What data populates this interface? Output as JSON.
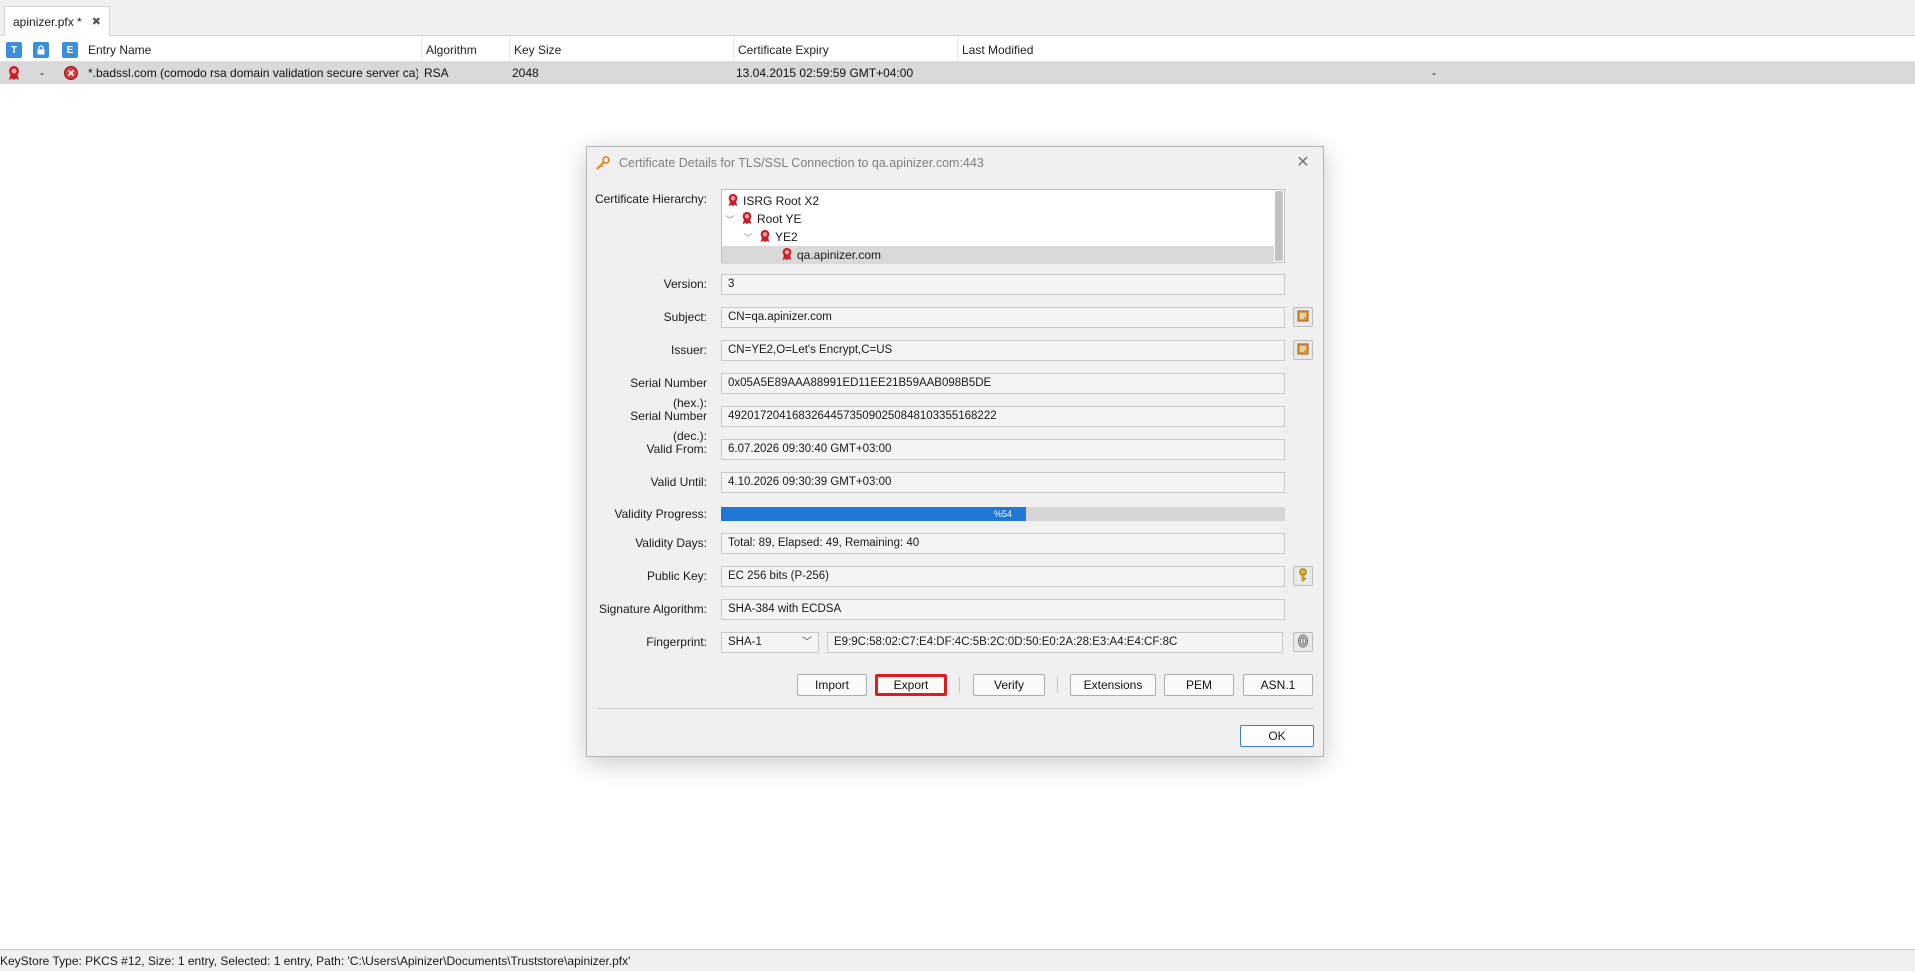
{
  "tab": {
    "title": "apinizer.pfx *",
    "close_glyph": "✖"
  },
  "table": {
    "header_icons": [
      "T",
      "🔒",
      "E"
    ],
    "columns": [
      "Entry Name",
      "Algorithm",
      "Key Size",
      "Certificate Expiry",
      "Last Modified"
    ],
    "rows": [
      {
        "lock": "-",
        "entry_name": "*.badssl.com (comodo rsa domain validation secure server ca)",
        "algorithm": "RSA",
        "key_size": "2048",
        "expiry": "13.04.2015 02:59:59 GMT+04:00",
        "last_modified": "-"
      }
    ]
  },
  "dialog": {
    "title": "Certificate Details for TLS/SSL Connection to qa.apinizer.com:443",
    "close_glyph": "✕",
    "labels": {
      "hierarchy": "Certificate Hierarchy:",
      "version": "Version:",
      "subject": "Subject:",
      "issuer": "Issuer:",
      "serial_hex": "Serial Number (hex.):",
      "serial_dec": "Serial Number (dec.):",
      "valid_from": "Valid From:",
      "valid_until": "Valid Until:",
      "validity_progress": "Validity Progress:",
      "validity_days": "Validity Days:",
      "public_key": "Public Key:",
      "signature_algorithm": "Signature Algorithm:",
      "fingerprint": "Fingerprint:"
    },
    "hierarchy": [
      {
        "label": "ISRG Root X2",
        "level": 0,
        "expanded": null,
        "selected": false
      },
      {
        "label": "Root YE",
        "level": 1,
        "expanded": true,
        "selected": false
      },
      {
        "label": "YE2",
        "level": 2,
        "expanded": true,
        "selected": false
      },
      {
        "label": "qa.apinizer.com",
        "level": 3,
        "expanded": null,
        "selected": true
      }
    ],
    "values": {
      "version": "3",
      "subject": "CN=qa.apinizer.com",
      "issuer": "CN=YE2,O=Let's Encrypt,C=US",
      "serial_hex": "0x05A5E89AAA88991ED11EE21B59AAB098B5DE",
      "serial_dec": "492017204168326445735090250848103355168222",
      "valid_from": "6.07.2026 09:30:40 GMT+03:00",
      "valid_until": "4.10.2026 09:30:39 GMT+03:00",
      "validity_progress_percent": 54,
      "validity_progress_text": "%54",
      "validity_days": "Total: 89, Elapsed: 49, Remaining: 40",
      "public_key": "EC 256 bits (P-256)",
      "signature_algorithm": "SHA-384 with ECDSA",
      "fingerprint_algorithm": "SHA-1",
      "fingerprint": "E9:9C:58:02:C7:E4:DF:4C:5B:2C:0D:50:E0:2A:28:E3:A4:E4:CF:8C"
    },
    "buttons": {
      "import": "Import",
      "export": "Export",
      "verify": "Verify",
      "extensions": "Extensions",
      "pem": "PEM",
      "asn1": "ASN.1",
      "ok": "OK"
    }
  },
  "statusbar": {
    "text": "KeyStore Type: PKCS #12, Size: 1 entry, Selected: 1 entry, Path: 'C:\\Users\\Apinizer\\Documents\\Truststore\\apinizer.pfx'"
  },
  "colors": {
    "accent_blue": "#1f77d6",
    "highlight_red": "#e01b1b",
    "selected_row": "#d9d9d9",
    "cert_red": "#c8202a"
  },
  "icons": {
    "certificate": "certificate-ribbon-icon",
    "error": "error-circle-icon",
    "fingerprint": "fingerprint-icon",
    "key": "key-icon",
    "details": "certificate-details-icon"
  }
}
